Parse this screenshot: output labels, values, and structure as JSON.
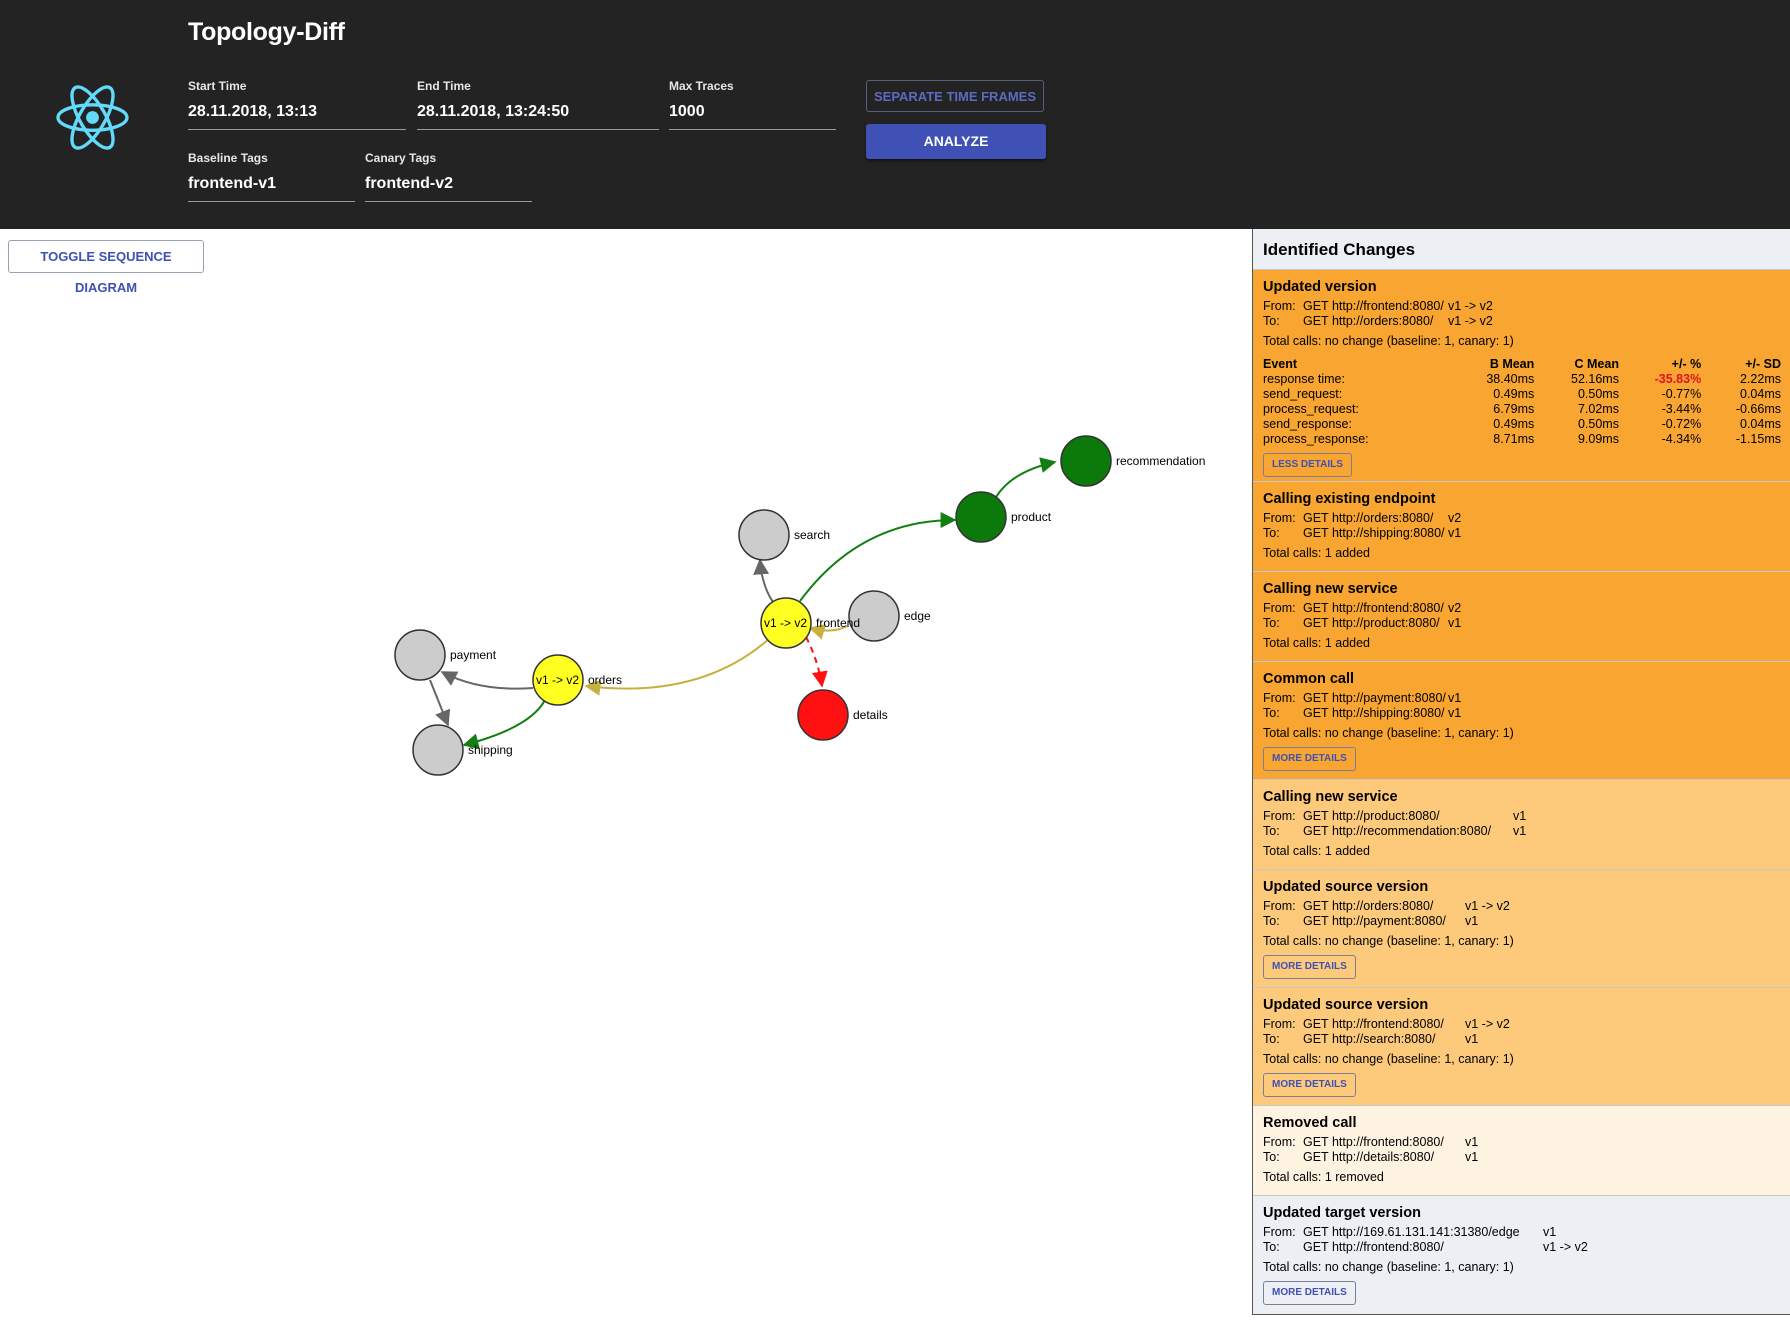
{
  "app": {
    "title": "Topology-Diff"
  },
  "form": {
    "start_time": {
      "label": "Start Time",
      "value": "28.11.2018, 13:13"
    },
    "end_time": {
      "label": "End Time",
      "value": "28.11.2018, 13:24:50"
    },
    "max_traces": {
      "label": "Max Traces",
      "value": "1000"
    },
    "baseline_tags": {
      "label": "Baseline Tags",
      "value": "frontend-v1"
    },
    "canary_tags": {
      "label": "Canary Tags",
      "value": "frontend-v2"
    },
    "separate_label": "SEPARATE TIME FRAMES",
    "analyze_label": "ANALYZE"
  },
  "toggle_label": "TOGGLE SEQUENCE DIAGRAM",
  "graph": {
    "nodes": [
      {
        "id": "recommendation",
        "label": "recommendation",
        "color": "#0b7a0b"
      },
      {
        "id": "product",
        "label": "product",
        "color": "#0b7a0b"
      },
      {
        "id": "search",
        "label": "search",
        "color": "#cccccc"
      },
      {
        "id": "edge",
        "label": "edge",
        "color": "#cccccc"
      },
      {
        "id": "frontend",
        "label": "frontend",
        "inner": "v1 -> v2",
        "color": "#ffff22"
      },
      {
        "id": "details",
        "label": "details",
        "color": "#ff1111"
      },
      {
        "id": "payment",
        "label": "payment",
        "color": "#cccccc"
      },
      {
        "id": "orders",
        "label": "orders",
        "inner": "v1 -> v2",
        "color": "#ffff22"
      },
      {
        "id": "shipping",
        "label": "shipping",
        "color": "#cccccc"
      }
    ],
    "edge_colors": {
      "added": "#127f12",
      "common": "#666666",
      "updated": "#c8b040",
      "removed": "#ff1111"
    }
  },
  "panel": {
    "title": "Identified Changes",
    "cards": [
      {
        "title": "Updated version",
        "from": "GET http://frontend:8080/",
        "from_ver": "v1 -> v2",
        "to": "GET http://orders:8080/",
        "to_ver": "v1 -> v2",
        "calls": "Total calls: no change (baseline: 1, canary: 1)",
        "table": {
          "headers": [
            "Event",
            "B Mean",
            "C Mean",
            "+/- %",
            "+/- SD"
          ],
          "rows": [
            [
              "response time:",
              "38.40ms",
              "52.16ms",
              "-35.83%",
              "2.22ms"
            ],
            [
              "send_request:",
              "0.49ms",
              "0.50ms",
              "-0.77%",
              "0.04ms"
            ],
            [
              "process_request:",
              "6.79ms",
              "7.02ms",
              "-3.44%",
              "-0.66ms"
            ],
            [
              "send_response:",
              "0.49ms",
              "0.50ms",
              "-0.72%",
              "0.04ms"
            ],
            [
              "process_response:",
              "8.71ms",
              "9.09ms",
              "-4.34%",
              "-1.15ms"
            ]
          ]
        },
        "button": "LESS DETAILS"
      },
      {
        "title": "Calling existing endpoint",
        "from": "GET http://orders:8080/",
        "from_ver": "v2",
        "to": "GET http://shipping:8080/",
        "to_ver": "v1",
        "calls": "Total calls: 1 added"
      },
      {
        "title": "Calling new service",
        "from": "GET http://frontend:8080/",
        "from_ver": "v2",
        "to": "GET http://product:8080/",
        "to_ver": "v1",
        "calls": "Total calls: 1 added"
      },
      {
        "title": "Common call",
        "from": "GET http://payment:8080/",
        "from_ver": "v1",
        "to": "GET http://shipping:8080/",
        "to_ver": "v1",
        "calls": "Total calls: no change (baseline: 1, canary: 1)",
        "button": "MORE DETAILS"
      },
      {
        "title": "Calling new service",
        "from": "GET http://product:8080/",
        "from_ver": "v1",
        "to": "GET http://recommendation:8080/",
        "to_ver": "v1",
        "calls": "Total calls: 1 added"
      },
      {
        "title": "Updated source version",
        "from": "GET http://orders:8080/",
        "from_ver": "v1 -> v2",
        "to": "GET http://payment:8080/",
        "to_ver": "v1",
        "calls": "Total calls: no change (baseline: 1, canary: 1)",
        "button": "MORE DETAILS"
      },
      {
        "title": "Updated source version",
        "from": "GET http://frontend:8080/",
        "from_ver": "v1 -> v2",
        "to": "GET http://search:8080/",
        "to_ver": "v1",
        "calls": "Total calls: no change (baseline: 1, canary: 1)",
        "button": "MORE DETAILS"
      },
      {
        "title": "Removed call",
        "from": "GET http://frontend:8080/",
        "from_ver": "v1",
        "to": "GET http://details:8080/",
        "to_ver": "v1",
        "calls": "Total calls: 1 removed"
      },
      {
        "title": "Updated target version",
        "from": "GET http://169.61.131.141:31380/edge",
        "from_ver": "v1",
        "to": "GET http://frontend:8080/",
        "to_ver": "v1 -> v2",
        "calls": "Total calls: no change (baseline: 1, canary: 1)",
        "button": "MORE DETAILS"
      }
    ]
  }
}
